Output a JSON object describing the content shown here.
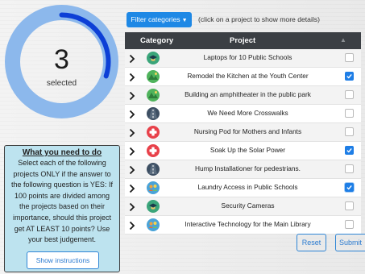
{
  "gauge": {
    "value": "3",
    "label": "selected",
    "fraction": 0.3,
    "track_color": "#8cb8ec",
    "fill_color": "#0d3fd6"
  },
  "info_box": {
    "title": "What you need to do",
    "lines": [
      "Select each of the following",
      "projects ONLY if the answer to",
      "the following question is YES: If",
      "100 points are divided among",
      "the projects based on their",
      "importance, should this project",
      "get AT LEAST 10 points? Use",
      "your best judgement."
    ],
    "button_label": "Show instructions"
  },
  "filter": {
    "button_label": "Filter categories",
    "hint": "(click on a project to show more details)"
  },
  "table": {
    "headers": {
      "category": "Category",
      "project": "Project"
    },
    "rows": [
      {
        "project": "Laptops for 10 Public Schools",
        "icon": "education-icon",
        "checked": false
      },
      {
        "project": "Remodel the Kitchen at the Youth Center",
        "icon": "parks-icon",
        "checked": true
      },
      {
        "project": "Building an amphitheater in the public park",
        "icon": "parks-icon",
        "checked": false
      },
      {
        "project": "We Need More Crosswalks",
        "icon": "road-icon",
        "checked": false
      },
      {
        "project": "Nursing Pod for Mothers and Infants",
        "icon": "health-icon",
        "checked": false
      },
      {
        "project": "Soak Up the Solar Power",
        "icon": "health-icon",
        "checked": true
      },
      {
        "project": "Hump Installationer for pedestrians.",
        "icon": "road-icon",
        "checked": false
      },
      {
        "project": "Laundry Access in Public Schools",
        "icon": "community-icon",
        "checked": true
      },
      {
        "project": "Security Cameras",
        "icon": "education-icon",
        "checked": false
      },
      {
        "project": "Interactive Technology for the Main Library",
        "icon": "community-icon",
        "checked": false
      }
    ]
  },
  "buttons": {
    "reset": "Reset",
    "submit": "Submit"
  },
  "colors": {
    "primary": "#1e88e5",
    "header": "#3b3f44",
    "info_bg": "#bde3ef"
  }
}
